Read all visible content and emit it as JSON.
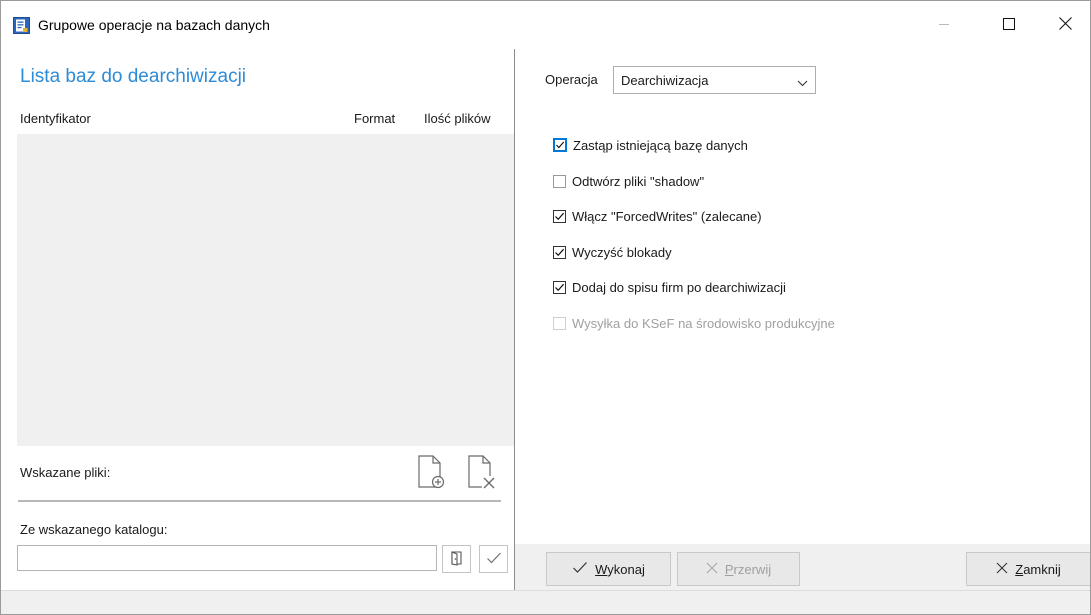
{
  "window": {
    "title": "Grupowe operacje na bazach danych",
    "icon": "database-app-icon",
    "controls": [
      "minimize-icon",
      "maximize-icon",
      "close-icon"
    ]
  },
  "left_panel": {
    "title": "Lista baz do dearchiwizacji",
    "columns": {
      "id": "Identyfikator",
      "format": "Format",
      "count": "Ilość plików"
    },
    "rows": [],
    "files_label": "Wskazane pliki:",
    "file_icons": {
      "add": "add-file-icon",
      "remove": "remove-file-icon"
    },
    "directory_label": "Ze wskazanego katalogu:",
    "directory_value": "",
    "directory_buttons": {
      "browse": "browse-folder-icon",
      "confirm": "checkmark-icon"
    }
  },
  "right_panel": {
    "operation_label": "Operacja",
    "operation_value": "Dearchiwizacja",
    "options": [
      {
        "label": "Zastąp istniejącą bazę danych",
        "checked": true,
        "enabled": true,
        "focused": true
      },
      {
        "label": "Odtwórz pliki \"shadow\"",
        "checked": false,
        "enabled": true,
        "focused": false
      },
      {
        "label": "Włącz \"ForcedWrites\" (zalecane)",
        "checked": true,
        "enabled": true,
        "focused": false
      },
      {
        "label": "Wyczyść blokady",
        "checked": true,
        "enabled": true,
        "focused": false
      },
      {
        "label": "Dodaj do spisu firm po dearchiwizacji",
        "checked": true,
        "enabled": true,
        "focused": false
      },
      {
        "label": "Wysyłka do KSeF na środowisko produkcyjne",
        "checked": false,
        "enabled": false,
        "focused": false
      }
    ],
    "buttons": {
      "execute": {
        "accel": "W",
        "rest": "ykonaj",
        "enabled": true
      },
      "stop": {
        "accel": "P",
        "rest": "rzerwij",
        "enabled": false
      },
      "close": {
        "accel": "Z",
        "rest": "amknij",
        "enabled": true
      }
    }
  },
  "colors": {
    "accent": "#2e8bd6",
    "list_background": "#f0f0f0",
    "focus_border": "#0078d7",
    "disabled_text": "#a0a0a0"
  }
}
